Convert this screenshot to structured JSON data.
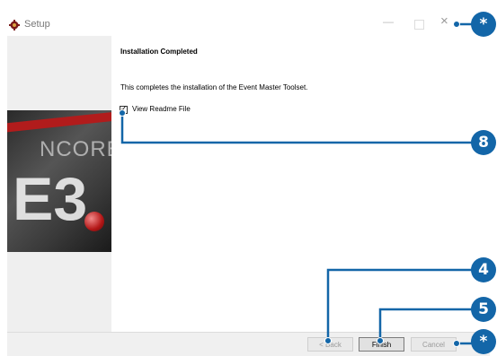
{
  "window": {
    "title": "Setup",
    "app_icon": "setup-icon",
    "controls": {
      "minimize": "—",
      "maximize": "☐",
      "close": "×"
    }
  },
  "banner": {
    "brand_text": "NCORE",
    "logo_text": "E3"
  },
  "content": {
    "heading": "Installation Completed",
    "message": "This completes the installation of the Event Master Toolset.",
    "readme_checkbox": {
      "label": "View Readme File",
      "checked": true,
      "mark": "✓"
    }
  },
  "buttons": {
    "back": "< Back",
    "finish": "Finish",
    "cancel": "Cancel"
  },
  "callouts": {
    "close": "*",
    "readme_checkbox": "8",
    "back": "4",
    "finish": "5",
    "cancel": "*"
  },
  "colors": {
    "callout": "#1366a8",
    "banner_accent": "#b11c1c"
  }
}
